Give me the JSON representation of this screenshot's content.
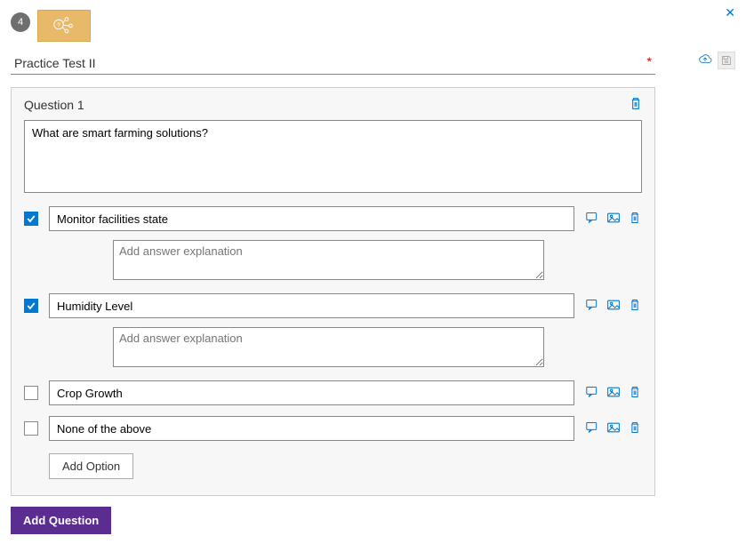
{
  "step_number": "4",
  "title": "Practice Test II",
  "required_marker": "*",
  "question": {
    "header": "Question 1",
    "text": "What are smart farming solutions?"
  },
  "options": [
    {
      "text": "Monitor facilities state",
      "checked": true,
      "show_explanation": true
    },
    {
      "text": "Humidity Level",
      "checked": true,
      "show_explanation": true
    },
    {
      "text": "Crop Growth",
      "checked": false,
      "show_explanation": false
    },
    {
      "text": "None of the above",
      "checked": false,
      "show_explanation": false
    }
  ],
  "placeholders": {
    "explanation": "Add answer explanation"
  },
  "buttons": {
    "add_option": "Add Option",
    "add_question": "Add Question"
  }
}
